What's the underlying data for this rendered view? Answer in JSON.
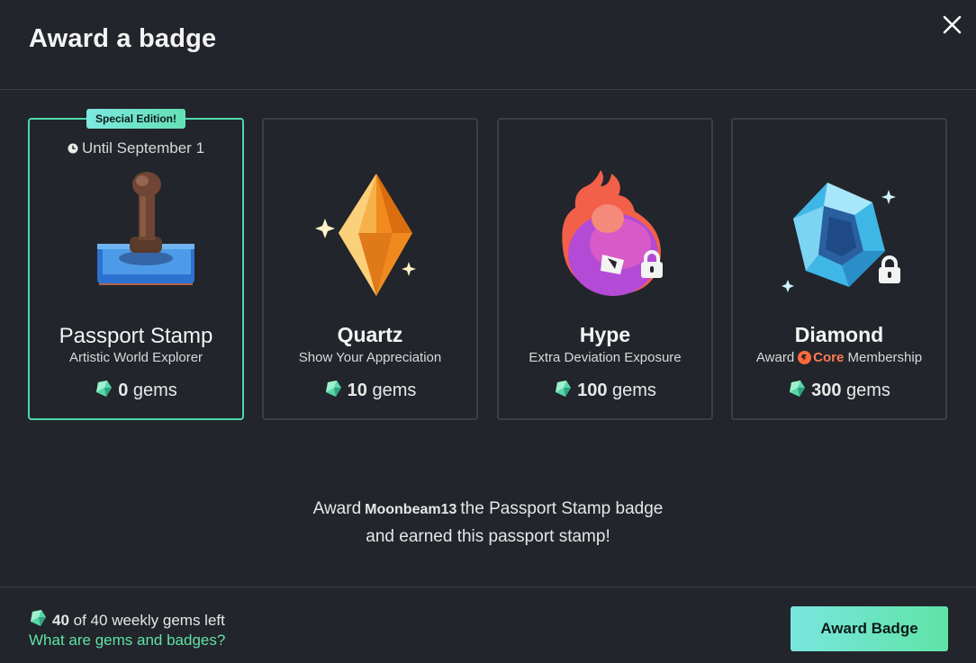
{
  "header": {
    "title": "Award a badge"
  },
  "badges": [
    {
      "special_label": "Special Edition!",
      "until": "Until September 1",
      "name": "Passport Stamp",
      "subtitle": "Artistic World Explorer",
      "price": "0",
      "unit": "gems",
      "icon": "passport-stamp-icon",
      "selected": true
    },
    {
      "name": "Quartz",
      "subtitle": "Show Your Appreciation",
      "price": "10",
      "unit": "gems",
      "icon": "quartz-crystal-icon"
    },
    {
      "name": "Hype",
      "subtitle": "Extra Deviation Exposure",
      "price": "100",
      "unit": "gems",
      "icon": "hype-flame-icon",
      "locked": true
    },
    {
      "name": "Diamond",
      "subtitle_prefix": "Award",
      "subtitle_brand": "Core",
      "subtitle_suffix": "Membership",
      "price": "300",
      "unit": "gems",
      "icon": "diamond-icon",
      "locked": true
    }
  ],
  "award_message": {
    "prefix": "Award",
    "username": "Moonbeam13",
    "suffix": "the Passport Stamp badge",
    "line2": "and earned this passport stamp!"
  },
  "footer": {
    "gems_count": "40",
    "gems_rest": "of 40 weekly gems left",
    "help_link": "What are gems and badges?",
    "award_button": "Award Badge"
  },
  "colors": {
    "background": "#22252b",
    "accent_green": "#5fe3a6",
    "accent_teal": "#79e6df",
    "core_orange": "#ff7a52",
    "selected_border": "#4fd8a8"
  }
}
